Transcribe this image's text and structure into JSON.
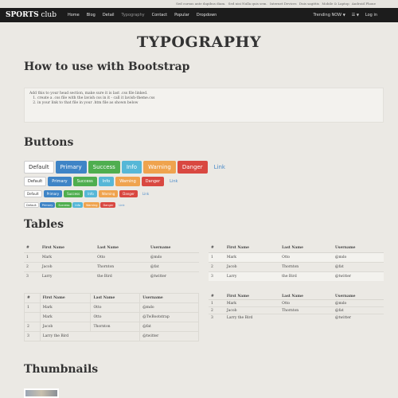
{
  "topbar": {
    "items": [
      "Sed cursus ante dapibus diam.",
      "Sed nisi Nulla quis sem.",
      "Internet Devices",
      "Duis sagittis",
      "Mobile & Laptop",
      "Android Phone"
    ]
  },
  "navbar": {
    "brand_bold": "SPORTS",
    "brand_light": "club",
    "items": [
      "Home",
      "Blog",
      "Detail",
      "Typography",
      "Contact",
      "Popular",
      "Dropdown"
    ],
    "trending": "Trending NOW",
    "menu_icon": "list-icon",
    "login": "Log in"
  },
  "page_title": "TYPOGRAPHY",
  "sections": {
    "bootstrap": "How to use with Bootstrap",
    "buttons": "Buttons",
    "tables": "Tables",
    "thumbnails": "Thumbnails"
  },
  "well": {
    "intro": "Add this to your head section, make sure it is last .css file linked.",
    "steps": [
      "create a .css file with the lavish css in it - call it lavish-theme.css",
      "in your link to that file in your .htm file as shown below"
    ]
  },
  "buttons": [
    "Default",
    "Primary",
    "Success",
    "Info",
    "Warning",
    "Danger",
    "Link"
  ],
  "tables": {
    "headers": [
      "#",
      "First Name",
      "Last Name",
      "Username"
    ],
    "rows": [
      [
        "1",
        "Mark",
        "Otto",
        "@mdo"
      ],
      [
        "2",
        "Jacob",
        "Thornton",
        "@fat"
      ],
      [
        "3",
        "Larry",
        "the Bird",
        "@twitter"
      ]
    ],
    "bordered_rows": [
      [
        "1",
        "Mark",
        "Otto",
        "@mdo"
      ],
      [
        "",
        "Mark",
        "Otto",
        "@TwBootstrap"
      ],
      [
        "2",
        "Jacob",
        "Thornton",
        "@fat"
      ],
      [
        "3",
        "Larry the Bird",
        "",
        "@twitter"
      ]
    ]
  },
  "colors": {
    "primary": "#3e84c6",
    "success": "#4fae4f",
    "info": "#56b7d7",
    "warning": "#efa34e",
    "danger": "#d94841",
    "nav_bg": "#1c1c1c",
    "page_bg": "#ebe9e4"
  }
}
